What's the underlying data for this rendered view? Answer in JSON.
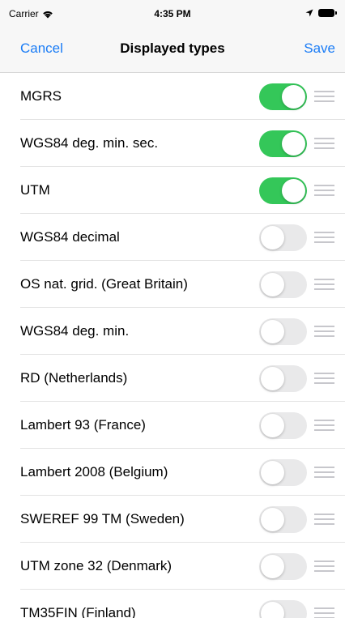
{
  "status_bar": {
    "carrier": "Carrier",
    "time": "4:35 PM",
    "wifi_icon": "wifi-icon",
    "location_icon": "location-arrow-icon",
    "battery_icon": "battery-icon"
  },
  "nav": {
    "cancel_label": "Cancel",
    "title": "Displayed types",
    "save_label": "Save"
  },
  "colors": {
    "accent": "#1a7cf6",
    "toggle_on": "#34c759",
    "toggle_off": "#e9e9ea"
  },
  "items": [
    {
      "label": "MGRS",
      "enabled": true
    },
    {
      "label": "WGS84 deg. min. sec.",
      "enabled": true
    },
    {
      "label": "UTM",
      "enabled": true
    },
    {
      "label": "WGS84 decimal",
      "enabled": false
    },
    {
      "label": "OS nat. grid. (Great Britain)",
      "enabled": false
    },
    {
      "label": "WGS84 deg. min.",
      "enabled": false
    },
    {
      "label": "RD (Netherlands)",
      "enabled": false
    },
    {
      "label": "Lambert 93 (France)",
      "enabled": false
    },
    {
      "label": "Lambert 2008 (Belgium)",
      "enabled": false
    },
    {
      "label": "SWEREF 99 TM (Sweden)",
      "enabled": false
    },
    {
      "label": "UTM zone 32 (Denmark)",
      "enabled": false
    },
    {
      "label": "TM35FIN (Finland)",
      "enabled": false
    }
  ]
}
